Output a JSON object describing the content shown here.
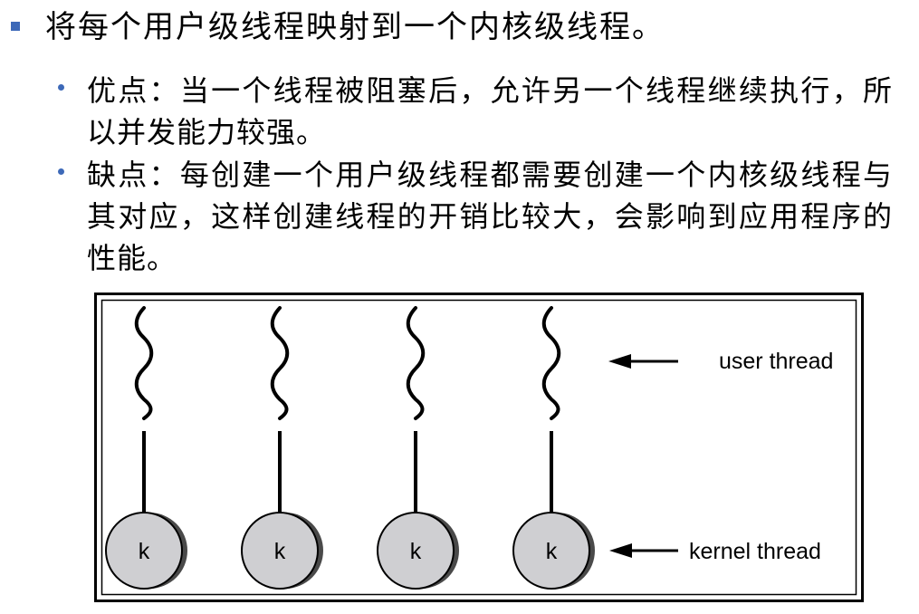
{
  "colors": {
    "bullet": "#3d69b8",
    "text": "#000000",
    "circle_fill": "#cfcfd2",
    "circle_shadow": "#4a4a4a"
  },
  "content": {
    "main_point": "将每个用户级线程映射到一个内核级线程。",
    "points": [
      {
        "text": "优点：当一个线程被阻塞后，允许另一个线程继续执行，所以并发能力较强。"
      },
      {
        "text": "缺点：每创建一个用户级线程都需要创建一个内核级线程与其对应，这样创建线程的开销比较大，会影响到应用程序的性能。"
      }
    ]
  },
  "diagram": {
    "kernel_threads": [
      {
        "label": "k"
      },
      {
        "label": "k"
      },
      {
        "label": "k"
      },
      {
        "label": "k"
      }
    ],
    "user_thread_label": "user thread",
    "kernel_thread_label": "kernel thread"
  }
}
